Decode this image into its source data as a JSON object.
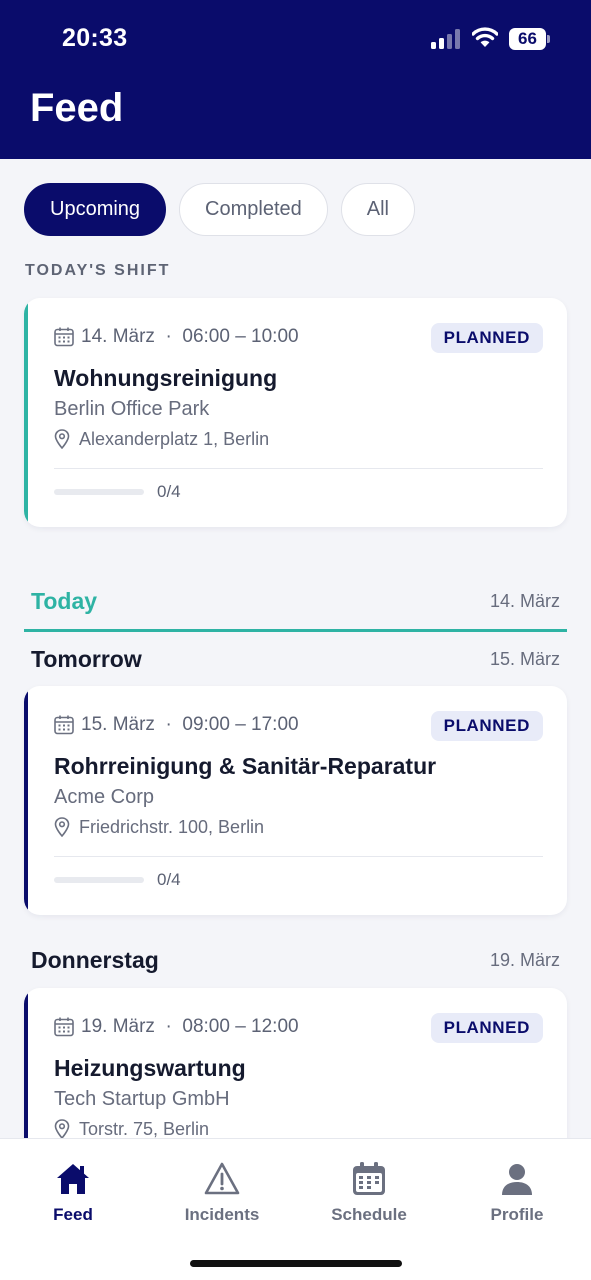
{
  "status_bar": {
    "time": "20:33",
    "battery": "66"
  },
  "header": {
    "title": "Feed"
  },
  "filters": [
    {
      "label": "Upcoming",
      "active": true
    },
    {
      "label": "Completed",
      "active": false
    },
    {
      "label": "All",
      "active": false
    }
  ],
  "todays_shift": {
    "label": "TODAY'S SHIFT",
    "card": {
      "date": "14. März",
      "separator": "·",
      "time": "06:00 – 10:00",
      "status": "PLANNED",
      "title": "Wohnungsreinigung",
      "company": "Berlin Office Park",
      "address": "Alexanderplatz 1, Berlin",
      "progress_text": "0/4",
      "progress": 0,
      "accent": "#2eb3a4"
    }
  },
  "days": [
    {
      "name": "Today",
      "date": "14. März",
      "color": "#2eb3a4"
    },
    {
      "name": "Tomorrow",
      "date": "15. März",
      "color": "#151a2e"
    },
    {
      "name": "Donnerstag",
      "date": "19. März",
      "color": "#151a2e"
    }
  ],
  "cards": [
    {
      "date": "15. März",
      "separator": "·",
      "time": "09:00 – 17:00",
      "status": "PLANNED",
      "title": "Rohrreinigung & Sanitär-Reparatur",
      "company": "Acme Corp",
      "address": "Friedrichstr. 100, Berlin",
      "progress_text": "0/4",
      "progress": 0,
      "accent": "#0a0c6b"
    },
    {
      "date": "19. März",
      "separator": "·",
      "time": "08:00 – 12:00",
      "status": "PLANNED",
      "title": "Heizungswartung",
      "company": "Tech Startup GmbH",
      "address": "Torstr. 75, Berlin",
      "accent": "#0a0c6b"
    }
  ],
  "tabbar": {
    "items": [
      {
        "label": "Feed",
        "icon": "home-icon",
        "active": true
      },
      {
        "label": "Incidents",
        "icon": "warning-icon",
        "active": false
      },
      {
        "label": "Schedule",
        "icon": "calendar-icon",
        "active": false
      },
      {
        "label": "Profile",
        "icon": "user-icon",
        "active": false
      }
    ]
  },
  "colors": {
    "brand": "#0a0c6b",
    "teal": "#2eb3a4",
    "background": "#f4f5f9"
  }
}
